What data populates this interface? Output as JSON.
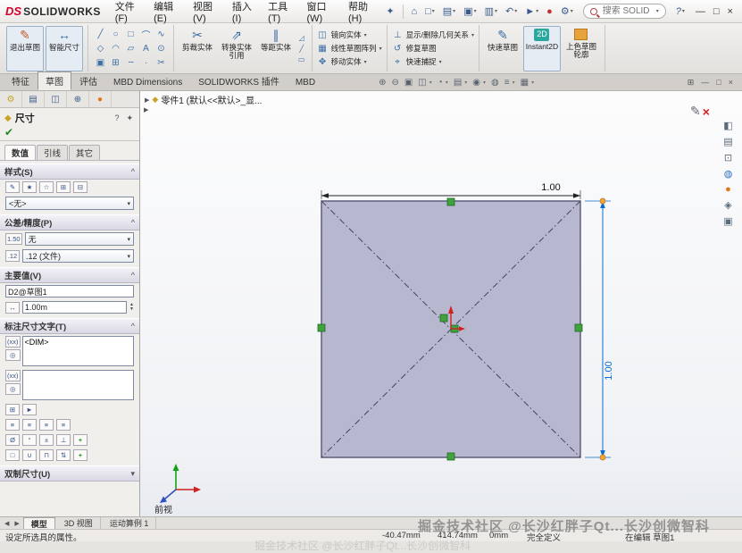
{
  "titlebar": {
    "logo_prefix": "DS",
    "logo_name": "SOLIDWORKS",
    "menus": [
      "文件(F)",
      "编辑(E)",
      "视图(V)",
      "插入(I)",
      "工具(T)",
      "窗口(W)",
      "帮助(H)"
    ],
    "search_placeholder": "搜索 SOLID"
  },
  "glyphs": {
    "pin": "✦",
    "caret": "▾",
    "chevron": "^",
    "check": "✔",
    "help": "?",
    "min": "—",
    "max": "□",
    "close": "×",
    "play": "▶",
    "part": "◆",
    "pencil": "✎",
    "redx": "×",
    "qat": [
      "⌂",
      "□",
      "▤",
      "▣",
      "▥",
      "↶",
      "►",
      "●",
      "⚙"
    ],
    "entity_grid": [
      "╱",
      "○",
      "□",
      "⌒",
      "∿",
      "◇",
      "◠",
      "▱",
      "A",
      "⊙",
      "▣",
      "⊞",
      "╌",
      "·",
      "✂"
    ],
    "view_toolbar": [
      "⊕",
      "⊖",
      "▣",
      "◫",
      "◔",
      "▤",
      "◉",
      "◍",
      "≡",
      "▦"
    ],
    "doc_controls": [
      "⊞",
      "—",
      "□",
      "×"
    ],
    "taskpane": [
      "◧",
      "▤",
      "⊡",
      "◍",
      "●",
      "◈",
      "▣"
    ],
    "style_icons": [
      "✎",
      "★",
      "☆",
      "⊞",
      "⊟"
    ],
    "tol_icon1": "1.50",
    "tol_icon2": ".12",
    "value_icon": "↔",
    "text_icon1": "(xx)",
    "text_icon2": "◎",
    "rowZ": [
      "⊞",
      "►"
    ],
    "rowA": [
      "≡",
      "≡",
      "≡",
      "≡"
    ],
    "rowB": [
      "Ø",
      "°",
      "±",
      "⊥",
      "+"
    ],
    "rowC": [
      "□",
      "∪",
      "⊓",
      "⇅",
      "+"
    ],
    "ribbon_icons": {
      "exit": "✎",
      "smart": "↔",
      "trim": "✂",
      "convert": "⇗",
      "offset": "∥",
      "mirror": "◫",
      "pattern": "▦",
      "move": "✥",
      "relations": "⊥",
      "repair": "↺",
      "snaps": "⌖",
      "rapid": "✎",
      "instant2d": "2D",
      "minicol0": "◿",
      "minicol1": "╱",
      "minicol2": "▭"
    }
  },
  "ribbon": {
    "exit_sketch": "退出草图",
    "smart_dimension": "智能尺寸",
    "trim": "剪裁实体",
    "convert": "转换实体引用",
    "offset": "等距实体",
    "mirror": "镜向实体",
    "linear_pattern": "线性草图阵列",
    "move": "移动实体",
    "relations": "显示/删除几何关系",
    "repair": "修复草图",
    "quick_snaps": "快速捕捉",
    "rapid_sketch": "快速草图",
    "instant2d": "Instant2D",
    "shaded_contours": "上色草图轮廓"
  },
  "tabs": [
    "特征",
    "草图",
    "评估",
    "MBD Dimensions",
    "SOLIDWORKS 插件",
    "MBD"
  ],
  "feature_tree": {
    "root": "零件1 (默认<<默认>_显..."
  },
  "panel": {
    "title": "尺寸",
    "value_tabs": [
      "数值",
      "引线",
      "其它"
    ],
    "sec_style": "样式(S)",
    "sec_tol": "公差/精度(P)",
    "sec_primary": "主要值(V)",
    "sec_text": "标注尺寸文字(T)",
    "sec_dual": "双制尺寸(U)",
    "style_value": "<无>",
    "tol_value": "无",
    "precision_value": ".12 (文件)",
    "dim_name": "D2@草图1",
    "dim_value": "1.00m",
    "dim_text": "<DIM>"
  },
  "viewport": {
    "dim_top": "1.00",
    "dim_right": "1.00",
    "view_label": "前视"
  },
  "doc_tabs": [
    "模型",
    "3D 视图",
    "运动算例 1"
  ],
  "statusbar": {
    "hint": "设定所选具的属性。",
    "x": "-40.47mm",
    "y": "414.74mm",
    "z": "0mm",
    "defined": "完全定义",
    "editing": "在编辑 草图1"
  },
  "watermark": {
    "line1": "掘金技术社区 @长沙红胖子Qt...长沙创微智科",
    "line2": "掘金技术社区 @长沙红胖子Qt...长沙创微智科"
  },
  "colors": {
    "dim_blue": "#0a6cd6",
    "relation_green": "#3fa23f",
    "square_fill": "#b7b7d0",
    "endpoint_orange": "#f2a33c"
  }
}
